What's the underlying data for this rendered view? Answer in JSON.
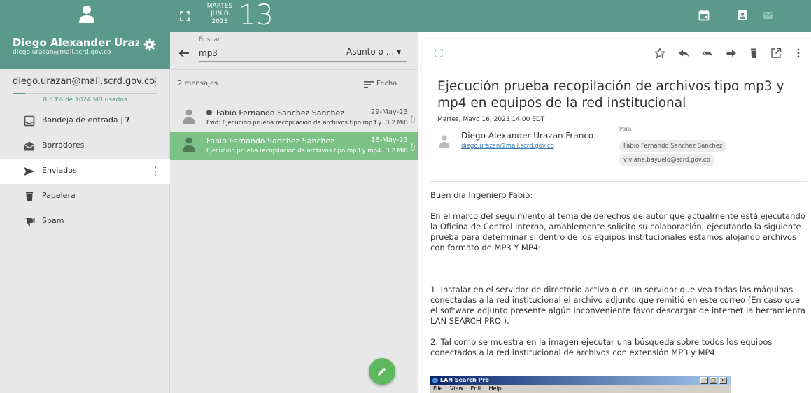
{
  "user": {
    "name": "Diego Alexander Urazan ...",
    "email": "diego.urazan@mail.scrd.gov.co"
  },
  "account": {
    "email": "diego.urazan@mail.scrd.gov.co",
    "quota_text": "8.53% de 1024 MB usados",
    "quota_fraction": 0.0853
  },
  "folders": [
    {
      "label": "Bandeja de entrada",
      "count": "7",
      "icon": "inbox-icon"
    },
    {
      "label": "Borradores",
      "icon": "drafts-icon"
    },
    {
      "label": "Enviados",
      "icon": "sent-icon"
    },
    {
      "label": "Papelera",
      "icon": "trash-icon"
    },
    {
      "label": "Spam",
      "icon": "spam-icon"
    }
  ],
  "calendar": {
    "weekday": "MARTES",
    "month": "JUNIO",
    "year": "2023",
    "day": "13"
  },
  "search": {
    "label": "Buscar",
    "value": "mp3",
    "field": "Asunto o ... ▾"
  },
  "list": {
    "count": "2 mensajes",
    "sort": "Fecha",
    "messages": [
      {
        "sender": "Fabio Fernando Sanchez Sanchez",
        "subject": "Fwd: Ejecución prueba recopilación de archivos tipo mp3 y ...",
        "date": "29-May-23",
        "size": "3.2 MiB",
        "unread": true,
        "selected": false
      },
      {
        "sender": "Fabio Fernando Sanchez Sanchez",
        "subject": "Ejecución prueba recopilación de archivos tipo mp3 y mp4 ...",
        "date": "16-May-23",
        "size": "3.2 MiB",
        "unread": false,
        "selected": true
      }
    ]
  },
  "message": {
    "subject": "Ejecución prueba recopilación de archivos tipo mp3 y mp4 en equipos de la red institucional",
    "date": "Martes, Mayo 16, 2023 14:00 EDT",
    "sender_name": "Diego Alexander Urazan Franco",
    "sender_email": "diego.urazan@mail.scrd.gov.co",
    "to_label": "Para",
    "recipients": [
      "Fabio Fernando Sanchez Sanchez",
      "viviana.bayuelo@scrd.gov.co"
    ],
    "body": [
      "Buen dia Ingeniero Fabio:",
      "En el marco del seguimiento al tema de derechos de autor que actualmente está ejecutando la Oficina de Control Interno, amablemente solicito su colaboración, ejecutando la siguiente prueba para determinar si dentro de los equipos institucionales estamos alojando archivos con formato de MP3 Y MP4:",
      "1. Instalar en el servidor de directorio activo o en un servidor que vea todas las máquinas conectadas a la red institucional el archivo adjunto que remitió en este correo (En caso que el software adjunto presente algún inconveniente favor descargar de internet la herramienta LAN SEARCH PRO ).",
      "2. Tal como se muestra en la imagen ejecutar una búsqueda sobre todos los equipos conectados a la red institucional de archivos con extensión MP3 y MP4"
    ],
    "screenshot": {
      "title": "LAN Search Pro",
      "menu": [
        "File",
        "View",
        "Edit",
        "Help"
      ],
      "controls": [
        "_",
        "□",
        "✕"
      ]
    }
  },
  "colors": {
    "header": "#5b9a8b",
    "selected_row": "#7cc286",
    "compose": "#5cb85c",
    "link": "#337ab7"
  }
}
